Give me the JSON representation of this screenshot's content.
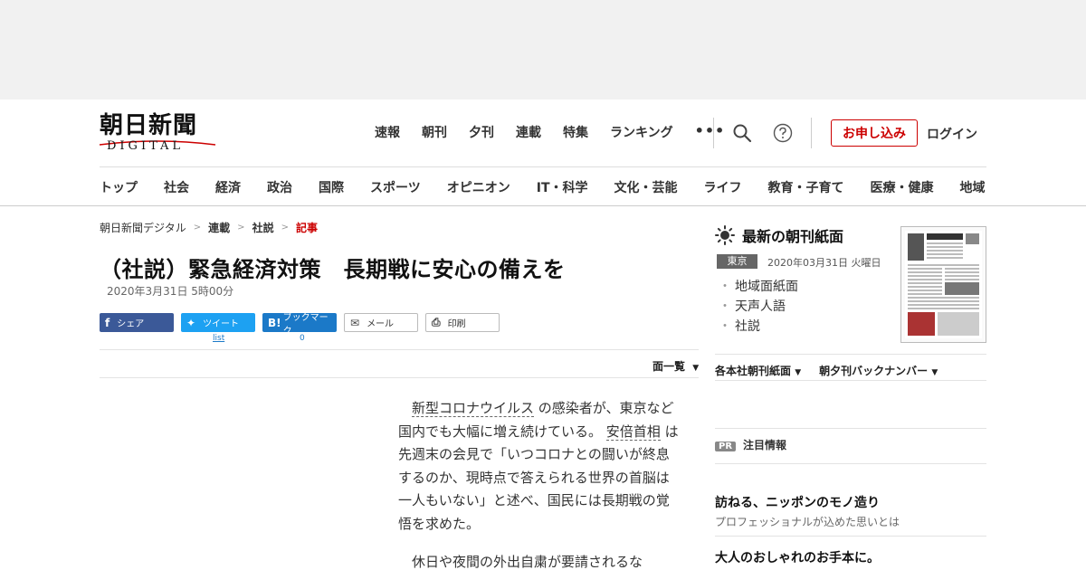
{
  "header": {
    "logo_jp": "朝日新聞",
    "logo_en": "DIGITAL",
    "nav": [
      "速報",
      "朝刊",
      "夕刊",
      "連載",
      "特集",
      "ランキング"
    ],
    "more": "•••",
    "apply": "お申し込み",
    "login": "ログイン"
  },
  "categories": [
    "トップ",
    "社会",
    "経済",
    "政治",
    "国際",
    "スポーツ",
    "オピニオン",
    "IT・科学",
    "文化・芸能",
    "ライフ",
    "教育・子育て",
    "医療・健康",
    "地域"
  ],
  "breadcrumb": [
    "朝日新聞デジタル",
    "連載",
    "社説",
    "記事"
  ],
  "article": {
    "title": "（社説）緊急経済対策　長期戦に安心の備えを",
    "date": "2020年3月31日 5時00分",
    "share": {
      "facebook": "シェア",
      "twitter": "ツイート",
      "hatena": "ブックマーク",
      "mail": "メール",
      "print": "印刷",
      "twitter_count": "list",
      "hatena_count": "0"
    },
    "page_list": "面一覧",
    "p1_link1": "新型コロナウイルス",
    "p1_a": "の感染者が、東京など国内でも大幅に増え続けている。",
    "p1_link2": "安倍首相",
    "p1_b": "は先週末の会見で「いつコロナとの闘いが終息するのか、現時点で答えられる世界の首脳は一人もいない」と述べ、国民には長期戦の覚悟を求めた。",
    "p2": "休日や夜間の外出自粛が要請されるな"
  },
  "sidebar": {
    "heading": "最新の朝刊紙面",
    "edition": "東京",
    "edition_date": "2020年03月31日 火曜日",
    "links": [
      "地域面紙面",
      "天声人語",
      "社説"
    ],
    "paper_link1": "各本社朝刊紙面",
    "paper_link2": "朝夕刊バックナンバー",
    "pr_badge": "PR",
    "pr_heading": "注目情報",
    "promo1_title": "訪ねる、ニッポンのモノ造り",
    "promo1_sub": "プロフェッショナルが込めた思いとは",
    "promo2_title": "大人のおしゃれのお手本に。"
  },
  "colors": {
    "accent": "#cc0000",
    "facebook": "#3b5998",
    "twitter": "#1da1f2",
    "hatena": "#1b79c8"
  },
  "icons": {
    "search": "search-icon",
    "help": "help-icon",
    "sun": "sun-icon"
  }
}
